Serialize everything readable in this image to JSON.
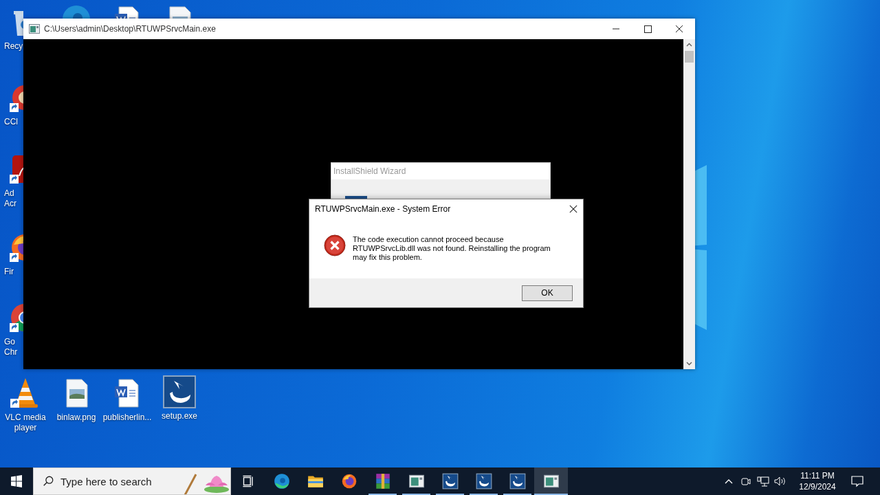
{
  "desktop_icons": [
    {
      "kind": "recycle",
      "shortcut": false,
      "label_lines": [
        "Recy"
      ]
    },
    {
      "kind": "ccleaner",
      "shortcut": true,
      "label_lines": [
        "CCl"
      ]
    },
    {
      "kind": "acrobat",
      "shortcut": true,
      "label_lines": [
        "Ad",
        "Acr"
      ]
    },
    {
      "kind": "firefox",
      "shortcut": true,
      "label_lines": [
        "Fir"
      ]
    },
    {
      "kind": "chrome",
      "shortcut": true,
      "label_lines": [
        "Go",
        "Chr"
      ]
    },
    {
      "kind": "edge"
    },
    {
      "kind": "word"
    },
    {
      "kind": "image"
    },
    {
      "kind": "vlc",
      "shortcut": true,
      "label_lines": [
        "VLC media",
        "player"
      ]
    },
    {
      "kind": "image",
      "shortcut": false,
      "label_lines": [
        "binlaw.png"
      ]
    },
    {
      "kind": "word",
      "shortcut": false,
      "label_lines": [
        "publisherlin..."
      ]
    },
    {
      "kind": "setup",
      "shortcut": false,
      "label_lines": [
        "setup.exe"
      ]
    }
  ],
  "console_window": {
    "title": "C:\\Users\\admin\\Desktop\\RTUWPSrvcMain.exe"
  },
  "installshield_dialog": {
    "title": "InstallShield Wizard"
  },
  "error_dialog": {
    "title": "RTUWPSrvcMain.exe - System Error",
    "message_lines": [
      "The code execution cannot proceed because",
      "RTUWPSrvcLib.dll was not found. Reinstalling the program",
      "may fix this problem."
    ],
    "button": "OK"
  },
  "taskbar": {
    "search_placeholder": "Type here to search",
    "apps": [
      {
        "kind": "taskview",
        "running": false,
        "active": false
      },
      {
        "kind": "edge",
        "running": false,
        "active": false
      },
      {
        "kind": "explorer",
        "running": false,
        "active": false
      },
      {
        "kind": "firefox",
        "running": false,
        "active": false
      },
      {
        "kind": "winrar",
        "running": true,
        "active": false
      },
      {
        "kind": "console",
        "running": true,
        "active": false
      },
      {
        "kind": "setup",
        "running": true,
        "active": false
      },
      {
        "kind": "setup",
        "running": true,
        "active": false
      },
      {
        "kind": "setup",
        "running": true,
        "active": false
      },
      {
        "kind": "console",
        "running": true,
        "active": true
      }
    ],
    "time": "11:11 PM",
    "date": "12/9/2024"
  }
}
